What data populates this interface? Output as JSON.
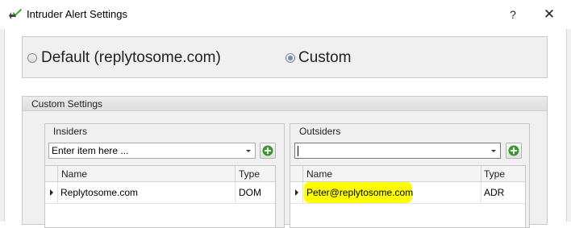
{
  "window": {
    "title": "Intruder Alert Settings",
    "help_label": "?",
    "close_label": "✕",
    "icon": "checkmark-arrow-icon"
  },
  "mode": {
    "default_label": "Default (replytosome.com)",
    "custom_label": "Custom",
    "selected": "custom"
  },
  "custom_settings": {
    "title": "Custom Settings",
    "insiders": {
      "title": "Insiders",
      "combo_value": "Enter item here ...",
      "columns": [
        "Name",
        "Type"
      ],
      "rows": [
        {
          "name": "Replytosome.com",
          "type": "DOM"
        }
      ]
    },
    "outsiders": {
      "title": "Outsiders",
      "combo_value": "",
      "columns": [
        "Name",
        "Type"
      ],
      "rows": [
        {
          "name": "Peter@replytosome.com",
          "type": "ADR",
          "highlighted": true
        }
      ]
    }
  },
  "colors": {
    "highlight": "#ffff00",
    "add_icon_green": "#3a9a2e",
    "panel_bg": "#f0f0f0"
  }
}
